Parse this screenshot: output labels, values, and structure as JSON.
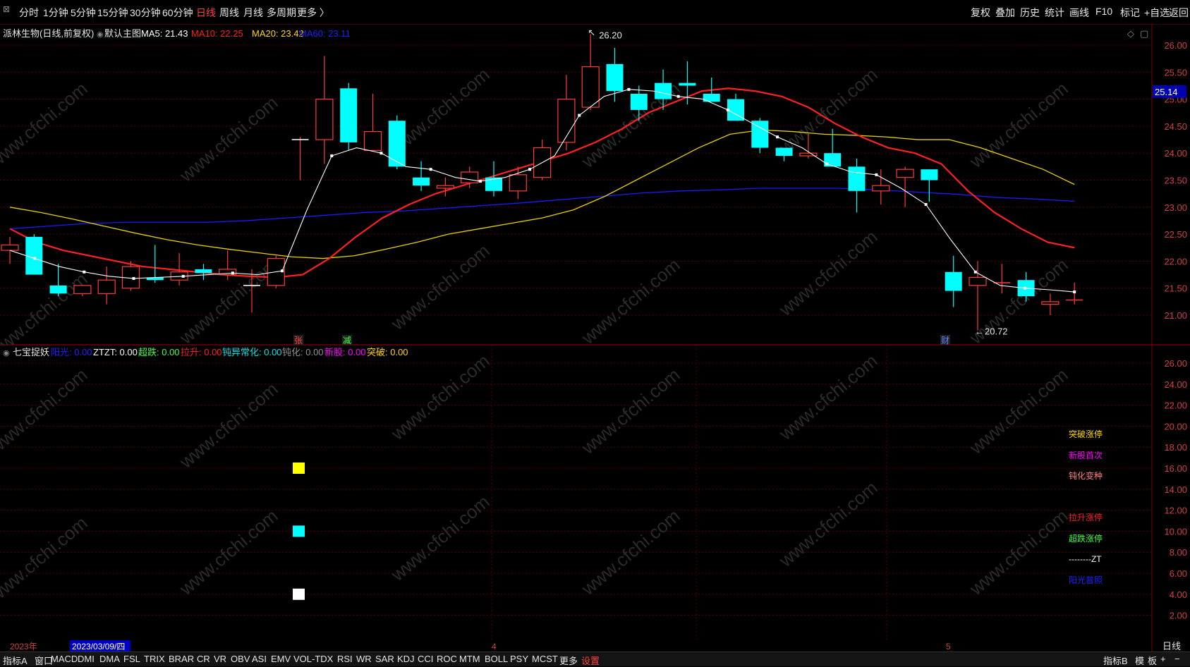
{
  "toolbar": {
    "left_items": [
      {
        "label": "分时",
        "active": false
      },
      {
        "label": "1分钟",
        "active": false
      },
      {
        "label": "5分钟",
        "active": false
      },
      {
        "label": "15分钟",
        "active": false
      },
      {
        "label": "30分钟",
        "active": false
      },
      {
        "label": "60分钟",
        "active": false
      },
      {
        "label": "日线",
        "active": true
      },
      {
        "label": "周线",
        "active": false
      },
      {
        "label": "月线",
        "active": false
      },
      {
        "label": "多周期",
        "active": false
      },
      {
        "label": "更多 〉",
        "active": false
      }
    ],
    "right_items": [
      "复权",
      "叠加",
      "历史",
      "统计",
      "画线",
      "F10",
      "标记",
      "+自选",
      "返回"
    ]
  },
  "main_chart": {
    "stock_title": "派林生物(日线,前复权)",
    "chart_name": "默认主图",
    "ma_labels": [
      {
        "text": "MA5: 21.43",
        "color": "#ffffff"
      },
      {
        "text": "MA10: 22.25",
        "color": "#ff2020"
      },
      {
        "text": "MA20: 23.42",
        "color": "#ffd700"
      },
      {
        "text": "MA60: 23.11",
        "color": "#2020ff"
      }
    ],
    "price_axis": [
      "26.00",
      "25.50",
      "25.00",
      "24.50",
      "24.00",
      "23.50",
      "23.00",
      "22.50",
      "22.00",
      "21.50",
      "21.00"
    ],
    "current_price": "25.14",
    "high_label": "26.20",
    "low_label": "20.72",
    "markers": [
      {
        "text": "张",
        "color": "#ff4040"
      },
      {
        "text": "减",
        "color": "#40ff40"
      },
      {
        "text": "财",
        "color": "#6080ff"
      }
    ]
  },
  "chart_data": {
    "type": "candlestick",
    "candles": [
      {
        "open": 22.2,
        "high": 22.45,
        "low": 21.95,
        "close": 22.3
      },
      {
        "open": 22.45,
        "high": 22.5,
        "low": 21.75,
        "close": 21.75
      },
      {
        "open": 21.55,
        "high": 21.95,
        "low": 21.35,
        "close": 21.4
      },
      {
        "open": 21.4,
        "high": 21.55,
        "low": 21.35,
        "close": 21.55
      },
      {
        "open": 21.4,
        "high": 21.9,
        "low": 21.2,
        "close": 21.65
      },
      {
        "open": 21.5,
        "high": 22.0,
        "low": 21.45,
        "close": 21.9
      },
      {
        "open": 21.7,
        "high": 22.3,
        "low": 21.6,
        "close": 21.65
      },
      {
        "open": 21.65,
        "high": 22.15,
        "low": 21.55,
        "close": 21.8
      },
      {
        "open": 21.85,
        "high": 21.95,
        "low": 21.65,
        "close": 21.78
      },
      {
        "open": 21.75,
        "high": 22.2,
        "low": 21.65,
        "close": 21.85
      },
      {
        "open": 21.55,
        "high": 21.85,
        "low": 21.05,
        "close": 21.55
      },
      {
        "open": 21.55,
        "high": 22.1,
        "low": 21.5,
        "close": 22.05
      },
      {
        "open": 24.25,
        "high": 24.3,
        "low": 23.5,
        "close": 24.25
      },
      {
        "open": 24.25,
        "high": 25.8,
        "low": 23.8,
        "close": 25.0
      },
      {
        "open": 25.2,
        "high": 25.3,
        "low": 24.05,
        "close": 24.2
      },
      {
        "open": 24.05,
        "high": 25.1,
        "low": 24.05,
        "close": 24.4
      },
      {
        "open": 24.6,
        "high": 24.7,
        "low": 23.7,
        "close": 23.75
      },
      {
        "open": 23.55,
        "high": 23.85,
        "low": 23.3,
        "close": 23.4
      },
      {
        "open": 23.35,
        "high": 23.55,
        "low": 23.2,
        "close": 23.4
      },
      {
        "open": 23.45,
        "high": 23.75,
        "low": 23.35,
        "close": 23.65
      },
      {
        "open": 23.55,
        "high": 23.85,
        "low": 23.2,
        "close": 23.3
      },
      {
        "open": 23.3,
        "high": 23.75,
        "low": 23.15,
        "close": 23.6
      },
      {
        "open": 23.55,
        "high": 24.25,
        "low": 23.5,
        "close": 24.1
      },
      {
        "open": 24.2,
        "high": 25.45,
        "low": 24.05,
        "close": 25.0
      },
      {
        "open": 24.85,
        "high": 26.2,
        "low": 24.8,
        "close": 25.6
      },
      {
        "open": 25.65,
        "high": 25.95,
        "low": 24.95,
        "close": 25.15
      },
      {
        "open": 25.1,
        "high": 25.25,
        "low": 24.6,
        "close": 24.8
      },
      {
        "open": 25.3,
        "high": 25.55,
        "low": 24.8,
        "close": 25.0
      },
      {
        "open": 25.3,
        "high": 25.7,
        "low": 24.9,
        "close": 25.25
      },
      {
        "open": 25.1,
        "high": 25.4,
        "low": 25.0,
        "close": 24.95
      },
      {
        "open": 25.0,
        "high": 25.1,
        "low": 24.65,
        "close": 24.6
      },
      {
        "open": 24.6,
        "high": 24.65,
        "low": 24.0,
        "close": 24.1
      },
      {
        "open": 24.1,
        "high": 24.1,
        "low": 23.85,
        "close": 23.95
      },
      {
        "open": 23.95,
        "high": 24.35,
        "low": 23.9,
        "close": 24.0
      },
      {
        "open": 24.0,
        "high": 24.45,
        "low": 23.75,
        "close": 23.75
      },
      {
        "open": 23.75,
        "high": 23.9,
        "low": 22.9,
        "close": 23.3
      },
      {
        "open": 23.3,
        "high": 23.7,
        "low": 23.05,
        "close": 23.4
      },
      {
        "open": 23.55,
        "high": 23.75,
        "low": 23.0,
        "close": 23.7
      },
      {
        "open": 23.7,
        "high": 23.7,
        "low": 23.1,
        "close": 23.5
      },
      {
        "open": 21.8,
        "high": 22.1,
        "low": 21.15,
        "close": 21.45
      },
      {
        "open": 21.55,
        "high": 22.0,
        "low": 20.72,
        "close": 21.7
      },
      {
        "open": 21.6,
        "high": 21.95,
        "low": 21.4,
        "close": 21.6
      },
      {
        "open": 21.65,
        "high": 21.8,
        "low": 21.25,
        "close": 21.35
      },
      {
        "open": 21.2,
        "high": 21.4,
        "low": 21.0,
        "close": 21.25
      },
      {
        "open": 21.28,
        "high": 21.6,
        "low": 21.2,
        "close": 21.28
      }
    ],
    "ma5": [
      22.2,
      22.05,
      21.9,
      21.8,
      21.72,
      21.68,
      21.7,
      21.72,
      21.75,
      21.78,
      21.75,
      21.82,
      22.95,
      23.95,
      24.1,
      24.0,
      23.75,
      23.7,
      23.55,
      23.48,
      23.55,
      23.7,
      23.95,
      24.7,
      25.05,
      25.18,
      25.15,
      25.05,
      25.0,
      24.8,
      24.55,
      24.3,
      24.1,
      23.8,
      23.65,
      23.6,
      23.35,
      23.05,
      22.4,
      21.8,
      21.55,
      21.5,
      21.47,
      21.43
    ],
    "ma10": [
      22.6,
      22.35,
      22.2,
      22.1,
      22.0,
      21.9,
      21.85,
      21.8,
      21.75,
      21.72,
      21.7,
      21.75,
      22.05,
      22.45,
      22.8,
      23.05,
      23.25,
      23.4,
      23.55,
      23.7,
      23.85,
      24.0,
      24.2,
      24.45,
      24.75,
      24.95,
      25.15,
      25.2,
      25.15,
      25.05,
      24.85,
      24.55,
      24.3,
      24.1,
      24.0,
      23.8,
      23.3,
      22.9,
      22.6,
      22.35,
      22.25
    ],
    "ma20": [
      23.0,
      22.9,
      22.78,
      22.65,
      22.52,
      22.4,
      22.3,
      22.22,
      22.15,
      22.08,
      22.05,
      22.1,
      22.22,
      22.35,
      22.5,
      22.6,
      22.7,
      22.8,
      22.95,
      23.2,
      23.5,
      23.8,
      24.1,
      24.35,
      24.43,
      24.4,
      24.35,
      24.33,
      24.3,
      24.25,
      24.25,
      24.1,
      23.9,
      23.7,
      23.42
    ],
    "ma60": [
      22.6,
      22.65,
      22.7,
      22.72,
      22.72,
      22.72,
      22.75,
      22.8,
      22.85,
      22.9,
      22.93,
      22.98,
      23.03,
      23.08,
      23.14,
      23.2,
      23.26,
      23.3,
      23.32,
      23.35,
      23.35,
      23.35,
      23.32,
      23.28,
      23.24,
      23.18,
      23.15,
      23.11
    ]
  },
  "sub_chart": {
    "indicator_name": "七宝捉妖",
    "labels": [
      {
        "text": "阳光: 0.00",
        "color": "#2020ff"
      },
      {
        "text": "ZTZT: 0.00",
        "color": "#ffffff"
      },
      {
        "text": "超跌: 0.00",
        "color": "#40ff40"
      },
      {
        "text": "拉升: 0.00",
        "color": "#ff2020"
      },
      {
        "text": "钝异常化: 0.00",
        "color": "#00e5e5"
      },
      {
        "text": "钝化: 0.00",
        "color": "#909090"
      },
      {
        "text": "新股: 0.00",
        "color": "#ff00ff"
      },
      {
        "text": "突破: 0.00",
        "color": "#ffd700"
      }
    ],
    "axis": [
      "26.00",
      "24.00",
      "22.00",
      "20.00",
      "18.00",
      "16.00",
      "14.00",
      "12.00",
      "10.00",
      "8.00",
      "6.00",
      "4.00",
      "2.00"
    ],
    "right_labels": [
      {
        "text": "突破涨停",
        "color": "#ffd700"
      },
      {
        "text": "新股首次",
        "color": "#ff00ff"
      },
      {
        "text": "钝化变种",
        "color": "#ff8080"
      },
      {
        "text": "拉升涨停",
        "color": "#ff2020"
      },
      {
        "text": "超跌涨停",
        "color": "#40ff40"
      },
      {
        "text": "--------ZT",
        "color": "#ffffff"
      },
      {
        "text": "阳光普照",
        "color": "#2020ff"
      }
    ],
    "signal_values": [
      16,
      10,
      4
    ]
  },
  "date_axis": {
    "year_label": "2023年",
    "cursor_date": "2023/03/09/四",
    "month_ticks": [
      "4",
      "5"
    ],
    "period_label": "日线"
  },
  "bottom_tabs": {
    "left": [
      "指标A",
      "窗口"
    ],
    "indicators": [
      "MACD",
      "DMI",
      "DMA",
      "FSL",
      "TRIX",
      "BRAR",
      "CR",
      "VR",
      "OBV",
      "ASI",
      "EMV",
      "VOL-TDX",
      "RSI",
      "WR",
      "SAR",
      "KDJ",
      "CCI",
      "ROC",
      "MTM",
      "BOLL",
      "PSY",
      "MCST",
      "更多"
    ],
    "settings": "设置",
    "right": [
      "指标B",
      "模",
      "板",
      "+",
      "−"
    ]
  },
  "watermark": "www.cfchi.com",
  "colors": {
    "up": "#ff3b3b",
    "down": "#00ffff",
    "ma5": "#ffffff",
    "ma10": "#ff2020",
    "ma20": "#e6d200",
    "ma60": "#1a1aff",
    "grid": "#5a0000"
  }
}
